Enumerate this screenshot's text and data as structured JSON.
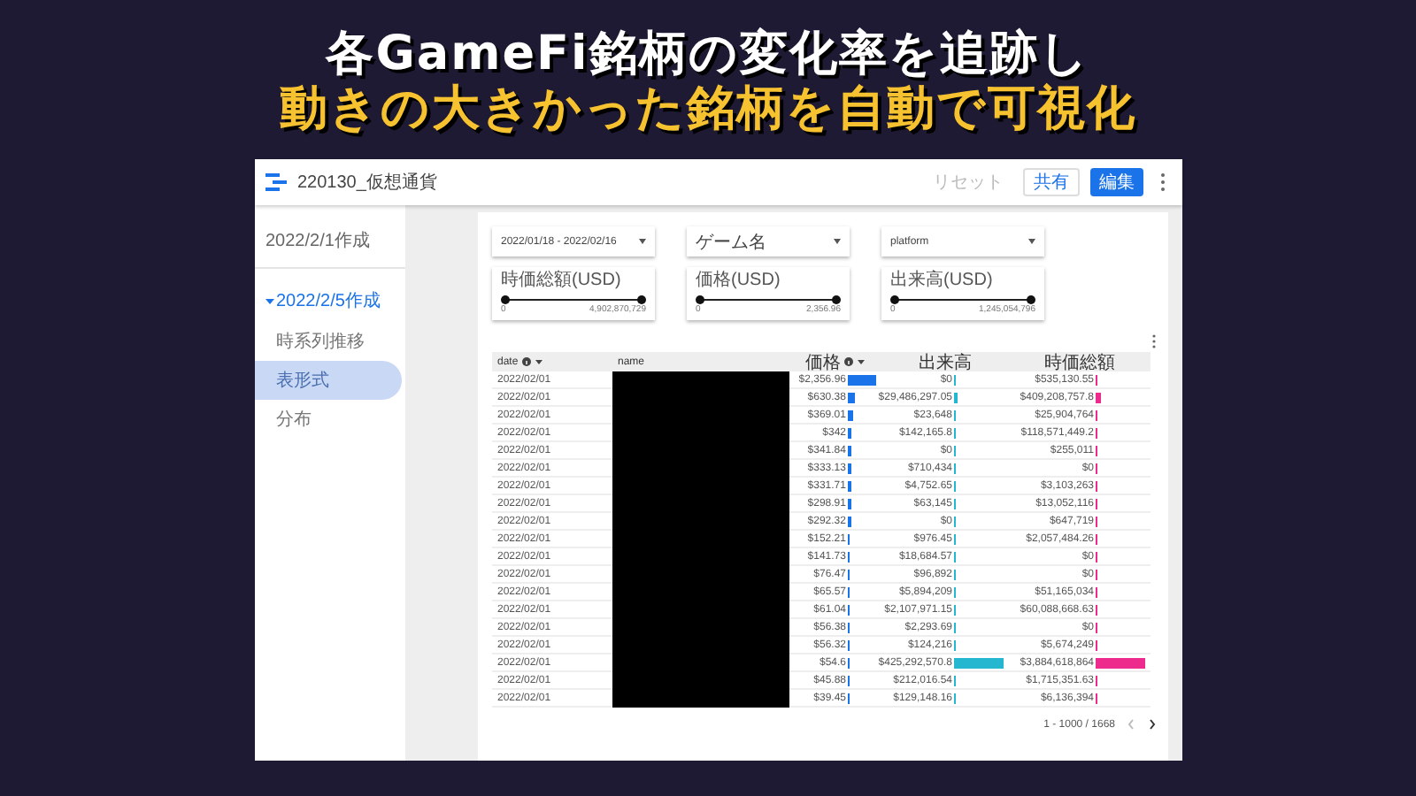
{
  "headline": [
    {
      "text": "各GameFi銘柄の変化率を追跡し",
      "color": "#ffffff"
    },
    {
      "text": "動きの大きかった銘柄を自動で可視化",
      "color": "#f7c230"
    }
  ],
  "app": {
    "title": "220130_仮想通貨",
    "buttons": [
      {
        "label": "リセット",
        "kind": "text",
        "disabled": true
      },
      {
        "label": "共有",
        "kind": "outlined",
        "disabled": false
      },
      {
        "label": "編集",
        "kind": "primary",
        "disabled": false
      }
    ]
  },
  "sidebar": {
    "items": [
      {
        "label": "2022/2/1作成",
        "expanded": false,
        "selected": false
      },
      {
        "label": "2022/2/5作成",
        "expanded": true,
        "selected": true,
        "children": [
          {
            "label": "時系列推移",
            "selected": false
          },
          {
            "label": "表形式",
            "selected": true
          },
          {
            "label": "分布",
            "selected": false
          }
        ]
      }
    ]
  },
  "filters": [
    {
      "value": "2022/01/18 - 2022/02/16"
    },
    {
      "value": "ゲーム名"
    },
    {
      "value": "platform"
    }
  ],
  "sliders": [
    {
      "label": "時価総額(USD)",
      "min": "0",
      "max": "4,902,870,729"
    },
    {
      "label": "価格(USD)",
      "min": "0",
      "max": "2,356.96"
    },
    {
      "label": "出来高(USD)",
      "min": "0",
      "max": "1,245,054,796"
    }
  ],
  "table": {
    "columns": [
      {
        "label": "date",
        "info": true,
        "sorted": true
      },
      {
        "label": "name",
        "info": false,
        "sorted": false
      },
      {
        "label": "価格",
        "info": true,
        "sorted": true,
        "color": "#1a73e8"
      },
      {
        "label": "出来高",
        "info": false,
        "sorted": false,
        "color": "#26b7d0"
      },
      {
        "label": "時価総額",
        "info": false,
        "sorted": false,
        "color": "#ec2b8c"
      }
    ],
    "name_redacted": true,
    "rows": [
      {
        "date": "2022/02/01",
        "price": "$2,356.96",
        "volume": "$0",
        "market_cap": "$535,130.55"
      },
      {
        "date": "2022/02/01",
        "price": "$630.38",
        "volume": "$29,486,297.05",
        "market_cap": "$409,208,757.8"
      },
      {
        "date": "2022/02/01",
        "price": "$369.01",
        "volume": "$23,648",
        "market_cap": "$25,904,764"
      },
      {
        "date": "2022/02/01",
        "price": "$342",
        "volume": "$142,165.8",
        "market_cap": "$118,571,449.2"
      },
      {
        "date": "2022/02/01",
        "price": "$341.84",
        "volume": "$0",
        "market_cap": "$255,011"
      },
      {
        "date": "2022/02/01",
        "price": "$333.13",
        "volume": "$710,434",
        "market_cap": "$0"
      },
      {
        "date": "2022/02/01",
        "price": "$331.71",
        "volume": "$4,752.65",
        "market_cap": "$3,103,263"
      },
      {
        "date": "2022/02/01",
        "price": "$298.91",
        "volume": "$63,145",
        "market_cap": "$13,052,116"
      },
      {
        "date": "2022/02/01",
        "price": "$292.32",
        "volume": "$0",
        "market_cap": "$647,719"
      },
      {
        "date": "2022/02/01",
        "price": "$152.21",
        "volume": "$976.45",
        "market_cap": "$2,057,484.26"
      },
      {
        "date": "2022/02/01",
        "price": "$141.73",
        "volume": "$18,684.57",
        "market_cap": "$0"
      },
      {
        "date": "2022/02/01",
        "price": "$76.47",
        "volume": "$96,892",
        "market_cap": "$0"
      },
      {
        "date": "2022/02/01",
        "price": "$65.57",
        "volume": "$5,894,209",
        "market_cap": "$51,165,034"
      },
      {
        "date": "2022/02/01",
        "price": "$61.04",
        "volume": "$2,107,971.15",
        "market_cap": "$60,088,668.63"
      },
      {
        "date": "2022/02/01",
        "price": "$56.38",
        "volume": "$2,293.69",
        "market_cap": "$0"
      },
      {
        "date": "2022/02/01",
        "price": "$56.32",
        "volume": "$124,216",
        "market_cap": "$5,674,249"
      },
      {
        "date": "2022/02/01",
        "price": "$54.6",
        "volume": "$425,292,570.8",
        "market_cap": "$3,884,618,864"
      },
      {
        "date": "2022/02/01",
        "price": "$45.88",
        "volume": "$212,016.54",
        "market_cap": "$1,715,351.63"
      },
      {
        "date": "2022/02/01",
        "price": "$39.45",
        "volume": "$129,148.16",
        "market_cap": "$6,136,394"
      }
    ],
    "pagination": {
      "range": "1 - 1000 / 1668",
      "prev_disabled": true,
      "next_disabled": false
    }
  }
}
